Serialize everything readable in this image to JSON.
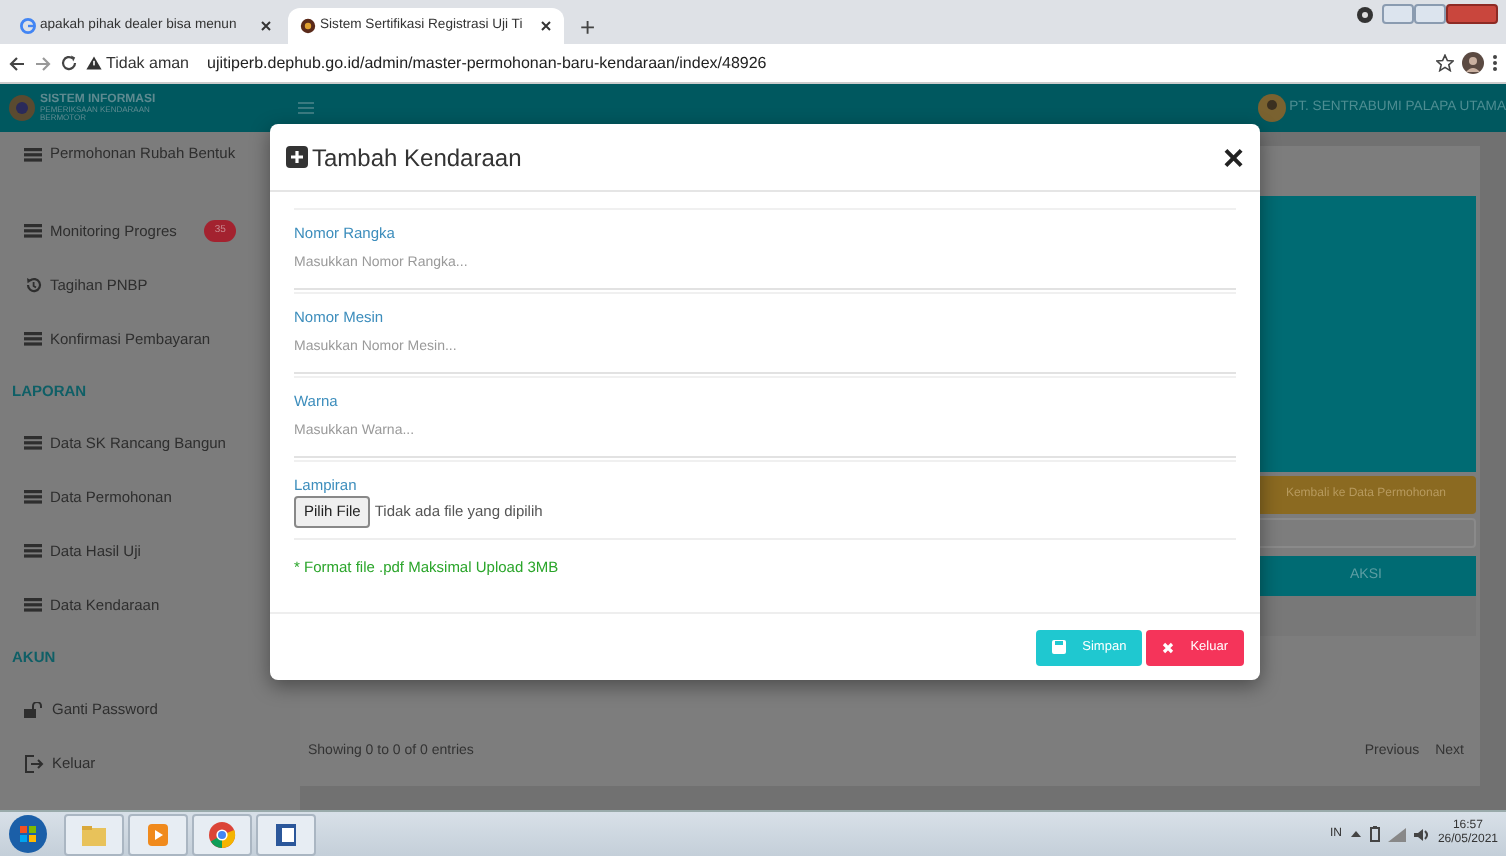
{
  "browser": {
    "tabs": [
      {
        "title": "apakah pihak dealer bisa menun",
        "kind": "google",
        "selected": false
      },
      {
        "title": "Sistem Sertifikasi Registrasi Uji Ti",
        "kind": "site",
        "selected": true
      }
    ],
    "new_tab": "+",
    "security": "Tidak aman",
    "url": "ujitiperb.dephub.go.id/admin/master-permohonan-baru-kendaraan/index/48926"
  },
  "header": {
    "logo_title": "SISTEM INFORMASI",
    "logo_subtitle": "PEMERIKSAAN KENDARAAN",
    "logo_subtitle_2": "BERMOTOR",
    "company": "PT. SENTRABUMI PALAPA UTAMA"
  },
  "sidebar": {
    "items": [
      {
        "kind": "menu",
        "label": "Permohonan Rubah Bentuk"
      },
      {
        "kind": "menu",
        "label": "Monitoring Progres",
        "badge": "35"
      },
      {
        "kind": "billing",
        "label": "Tagihan PNBP"
      },
      {
        "kind": "menu",
        "label": "Konfirmasi Pembayaran"
      },
      {
        "kind": "section",
        "label": "LAPORAN"
      },
      {
        "kind": "menu",
        "label": "Data SK Rancang Bangun"
      },
      {
        "kind": "menu",
        "label": "Data Permohonan"
      },
      {
        "kind": "menu",
        "label": "Data Hasil Uji"
      },
      {
        "kind": "menu",
        "label": "Data Kendaraan"
      },
      {
        "kind": "section",
        "label": "AKUN"
      },
      {
        "kind": "password",
        "label": "Ganti Password"
      },
      {
        "kind": "logout",
        "label": "Keluar"
      }
    ]
  },
  "main": {
    "back_button": "Kembali ke Data Permohonan",
    "table": {
      "columns": [
        "AKSI"
      ]
    },
    "info": "Showing 0 to 0 of 0 entries",
    "pagination": [
      "Previous",
      "Next"
    ]
  },
  "modal": {
    "title": "Tambah Kendaraan",
    "close": "×",
    "fields": [
      {
        "label": "Nomor Rangka",
        "placeholder": "Masukkan Nomor Rangka..."
      },
      {
        "label": "Nomor Mesin",
        "placeholder": "Masukkan Nomor Mesin..."
      },
      {
        "label": "Warna",
        "placeholder": "Masukkan Warna..."
      }
    ],
    "file": {
      "label": "Lampiran",
      "button": "Pilih File",
      "status": "Tidak ada file yang dipilih"
    },
    "note": "* Format file .pdf Maksimal Upload 3MB",
    "buttons": [
      {
        "kind": "save",
        "label": "Simpan"
      },
      {
        "kind": "cancel",
        "label": "Keluar"
      }
    ]
  },
  "taskbar": {
    "language": "IN",
    "time": "16:57",
    "date": "26/05/2021"
  }
}
